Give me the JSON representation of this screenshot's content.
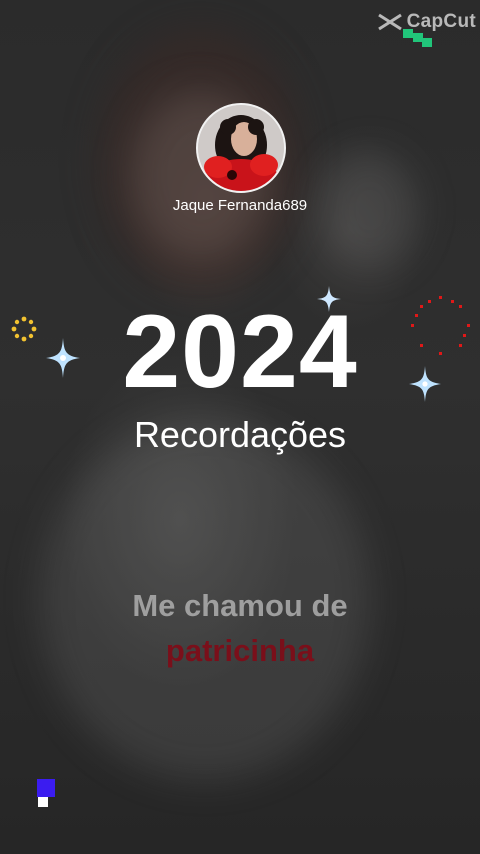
{
  "watermark": {
    "text": "CapCut",
    "icon": "capcut-logo-icon",
    "accent": "#21c57a"
  },
  "profile": {
    "username": "Jaque Fernanda689",
    "avatar": "avatar-photo"
  },
  "headline": {
    "year": "2024",
    "subtitle": "Recordações"
  },
  "caption": {
    "line1": "Me chamou de",
    "line2": "patricinha",
    "line2_color": "#7a0f1a"
  },
  "decorations": {
    "sparkle_icons": [
      "sparkle-icon",
      "sparkle-icon",
      "sparkle-icon"
    ],
    "firework_icons": [
      "yellow-firework-icon",
      "red-firework-icon"
    ],
    "colors": {
      "sparkle": "#bfe3ff",
      "firework_yellow": "#f2c230",
      "firework_red": "#e01818",
      "block_blue": "#3b1cf0"
    }
  }
}
